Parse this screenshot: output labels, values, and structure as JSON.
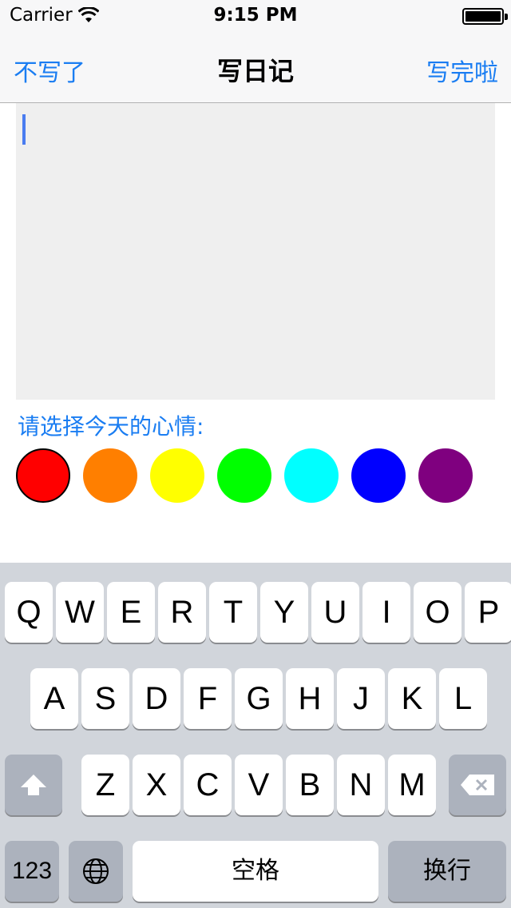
{
  "status_bar": {
    "carrier": "Carrier",
    "time": "9:15 PM"
  },
  "nav": {
    "left_button": "不写了",
    "title": "写日记",
    "right_button": "写完啦"
  },
  "editor": {
    "text": ""
  },
  "mood": {
    "label": "请选择今天的心情:",
    "colors": [
      "#ff0000",
      "#ff7f00",
      "#ffff00",
      "#00ff00",
      "#00ffff",
      "#0000ff",
      "#7f007f"
    ],
    "selected_index": 0
  },
  "keyboard": {
    "row1": [
      "Q",
      "W",
      "E",
      "R",
      "T",
      "Y",
      "U",
      "I",
      "O",
      "P"
    ],
    "row2": [
      "A",
      "S",
      "D",
      "F",
      "G",
      "H",
      "J",
      "K",
      "L"
    ],
    "row3": [
      "Z",
      "X",
      "C",
      "V",
      "B",
      "N",
      "M"
    ],
    "numbers_key": "123",
    "space_key": "空格",
    "return_key": "换行"
  }
}
